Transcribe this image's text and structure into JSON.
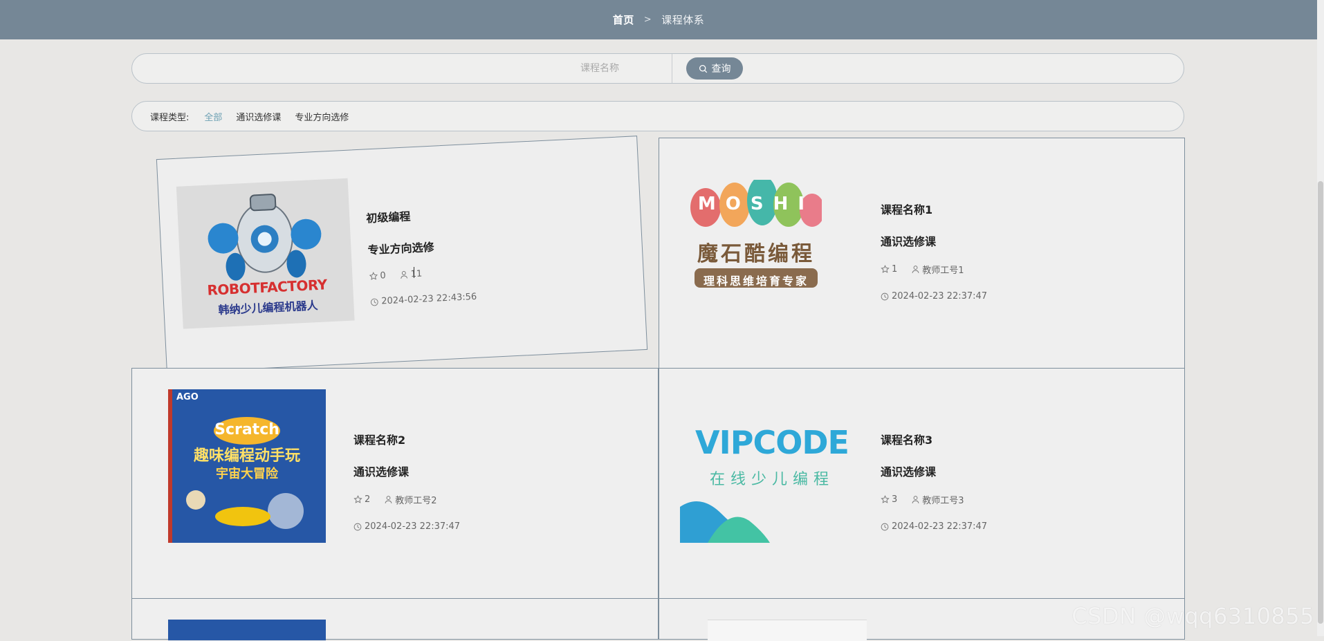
{
  "breadcrumb": {
    "home": "首页",
    "separator": ">",
    "current": "课程体系"
  },
  "search": {
    "placeholder": "课程名称",
    "button_label": "查询"
  },
  "filter": {
    "label": "课程类型:",
    "options": [
      "全部",
      "通识选修课",
      "专业方向选修"
    ],
    "active": "全部"
  },
  "courses": [
    {
      "name": "初级编程",
      "type": "专业方向选修",
      "favorites": "0",
      "teacher": "11",
      "time": "2024-02-23 22:43:56",
      "image": {
        "line1": "ROBOTFACTORY",
        "line2": "韩纳少儿编程机器人"
      }
    },
    {
      "name": "课程名称1",
      "type": "通识选修课",
      "favorites": "1",
      "teacher": "教师工号1",
      "time": "2024-02-23 22:37:47",
      "image": {
        "line1": "MOSHI",
        "line2": "魔石酷编程",
        "line3": "理科思维培育专家"
      }
    },
    {
      "name": "课程名称2",
      "type": "通识选修课",
      "favorites": "2",
      "teacher": "教师工号2",
      "time": "2024-02-23 22:37:47",
      "image": {
        "line1": "AGO",
        "line2": "Scratch",
        "line3": "趣味编程动手玩",
        "line4": "宇宙大冒险"
      }
    },
    {
      "name": "课程名称3",
      "type": "通识选修课",
      "favorites": "3",
      "teacher": "教师工号3",
      "time": "2024-02-23 22:37:47",
      "image": {
        "line1": "VIPCODE",
        "line2": "在线少儿编程"
      }
    }
  ],
  "watermark": "CSDN @wqq6310855",
  "colors": {
    "topbar": "#758796",
    "accent": "#6ea1b4",
    "border": "#7d8e9c"
  }
}
